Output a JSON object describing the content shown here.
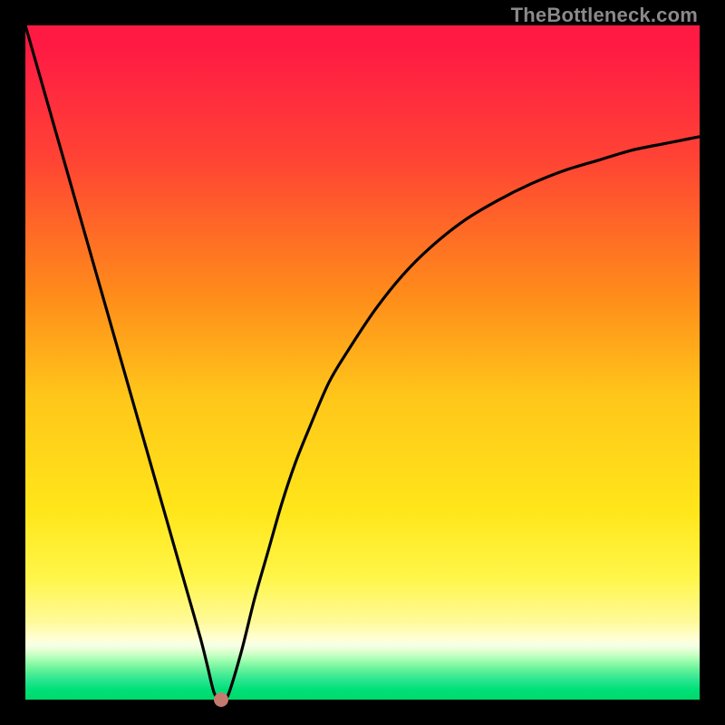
{
  "watermark": "TheBottleneck.com",
  "colors": {
    "background": "#000000",
    "top": "#ff1a44",
    "mid": "#ffe61a",
    "bottom": "#00d96a",
    "curve": "#000000",
    "marker": "#c67a6e"
  },
  "chart_data": {
    "type": "line",
    "title": "",
    "xlabel": "",
    "ylabel": "",
    "xlim": [
      0,
      100
    ],
    "ylim": [
      0,
      100
    ],
    "grid": false,
    "legend": false,
    "annotations": [
      "TheBottleneck.com"
    ],
    "x": [
      0,
      2,
      4,
      6,
      8,
      10,
      12,
      14,
      16,
      18,
      20,
      22,
      24,
      26,
      27,
      28,
      29,
      30,
      32,
      34,
      36,
      38,
      40,
      42,
      45,
      48,
      52,
      56,
      60,
      65,
      70,
      75,
      80,
      85,
      90,
      95,
      100
    ],
    "values": [
      100,
      93,
      86,
      79,
      72,
      65,
      58,
      51,
      44,
      37,
      30,
      23,
      16,
      9,
      5,
      1,
      0,
      0.5,
      7,
      15,
      22,
      29,
      35,
      40,
      47,
      52,
      58,
      63,
      67,
      71,
      74,
      76.5,
      78.5,
      80,
      81.5,
      82.5,
      83.5
    ],
    "marker": {
      "x": 29,
      "y": 0
    }
  }
}
